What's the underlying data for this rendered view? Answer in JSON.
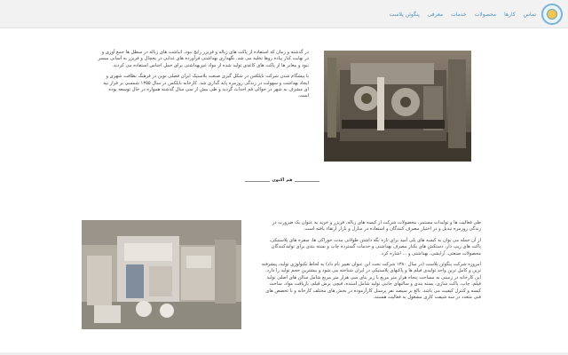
{
  "header": {
    "logo_icon": "company-logo-icon",
    "nav": [
      {
        "label": "پنگوئن پلاست"
      },
      {
        "label": "معرفی"
      },
      {
        "label": "خدمات"
      },
      {
        "label": "محصولات"
      },
      {
        "label": "کارها"
      },
      {
        "label": "تماس"
      }
    ]
  },
  "section1": {
    "paragraphs": [
      "در گذشته و زمان که استفاده از پاکت های زباله و فریزر رایج نبود، انباشت های زباله در سطل ها جمع آوری و در نهایت کنار پیاده روها تخلیه می شد. نگهداری بهداشتی فرآورده های غذایی در یخچال و فریزر به آسانی میسر نبود و معابر ها از پاکت های کاغذی تولید شده از مواد غیربهداشتی برای حمل اجناس استفاده می کردند.",
      "با پیشگام شدن شرکت نایلکس در شکل گیری صنعت پلاستیک ایران فصلی نوین در فرهنگ نظافت شهری و ایجاد بهداشت و سهولت در زندگی روزمره پایه گذاری شد. کارخانه نایلکس در سال ۱۳۵۵ شمسی بر فراز تپه ای مشرف به شهر در حوالی قم احداث گردید و طی بیش از سی سال گذشته همواره در حال توسعه بوده است."
    ]
  },
  "divider": {
    "label": "هم اکنون"
  },
  "section2": {
    "paragraphs": [
      "طی فعالیت ها و تولیدات مستمر، محصولات شرکت از کیسه های زباله، فریزر و خرید به عنوان یک ضرورت در زندگی روزمره تبدیل و در اختیار مصرف کنندگان و استفاده در منازل و بازار ارتقاء یافته است.",
      "از آن جمله می توان به کیسه های پلی آمید برای تازه نگه داشتن طولانی مدت خوراکی ها، سفره های پلاستیکی، پاکت های زیپ دار، دستکش های یکبار مصرف بهداشتی و خدمات گسترده چاپ و بسته بندی برای تولیدکنندگان محصولات صنعتی، آرایشی، بهداشتی و ... اشاره کرد.",
      "امروزه شرکت پنگوئن پلاست (در سال ۱۳۸۰ شرکت تحت این عنوان تغییر نام داد) به لحاظ تکنولوژی تولید، پیشرفته ترین و کامل ترین واحد تولیدی فیلم ها و پاکتهای پلاستیکی در ایران شناخته می شود و بیشترین حجم تولید را دارد. این کارخانه در زمینی به مساحت پنجاه هزار متر مربع با زیر بنای سی هزار متر مربع شامل سالن های اصلی تولید فیلم، چاپ، پاکت سازی، بسته بندی و سالنهای جانبی تولید شامل امبتده، قیچی برش قیلم، بازیافت مواد، ساخت کیسه و کنترل کیفیت می باشد. بالغ بر سیصد نفر پرسنل کارآزموده در بخش های مختلف کارخانه و با تخصص های فنی متعدد در سه شیفت کاری مشغول به فعالیت هستند."
    ]
  },
  "colors": {
    "nav_link": "#4a8cb8",
    "header_bg": "#f2f2f2",
    "text": "#444444"
  }
}
